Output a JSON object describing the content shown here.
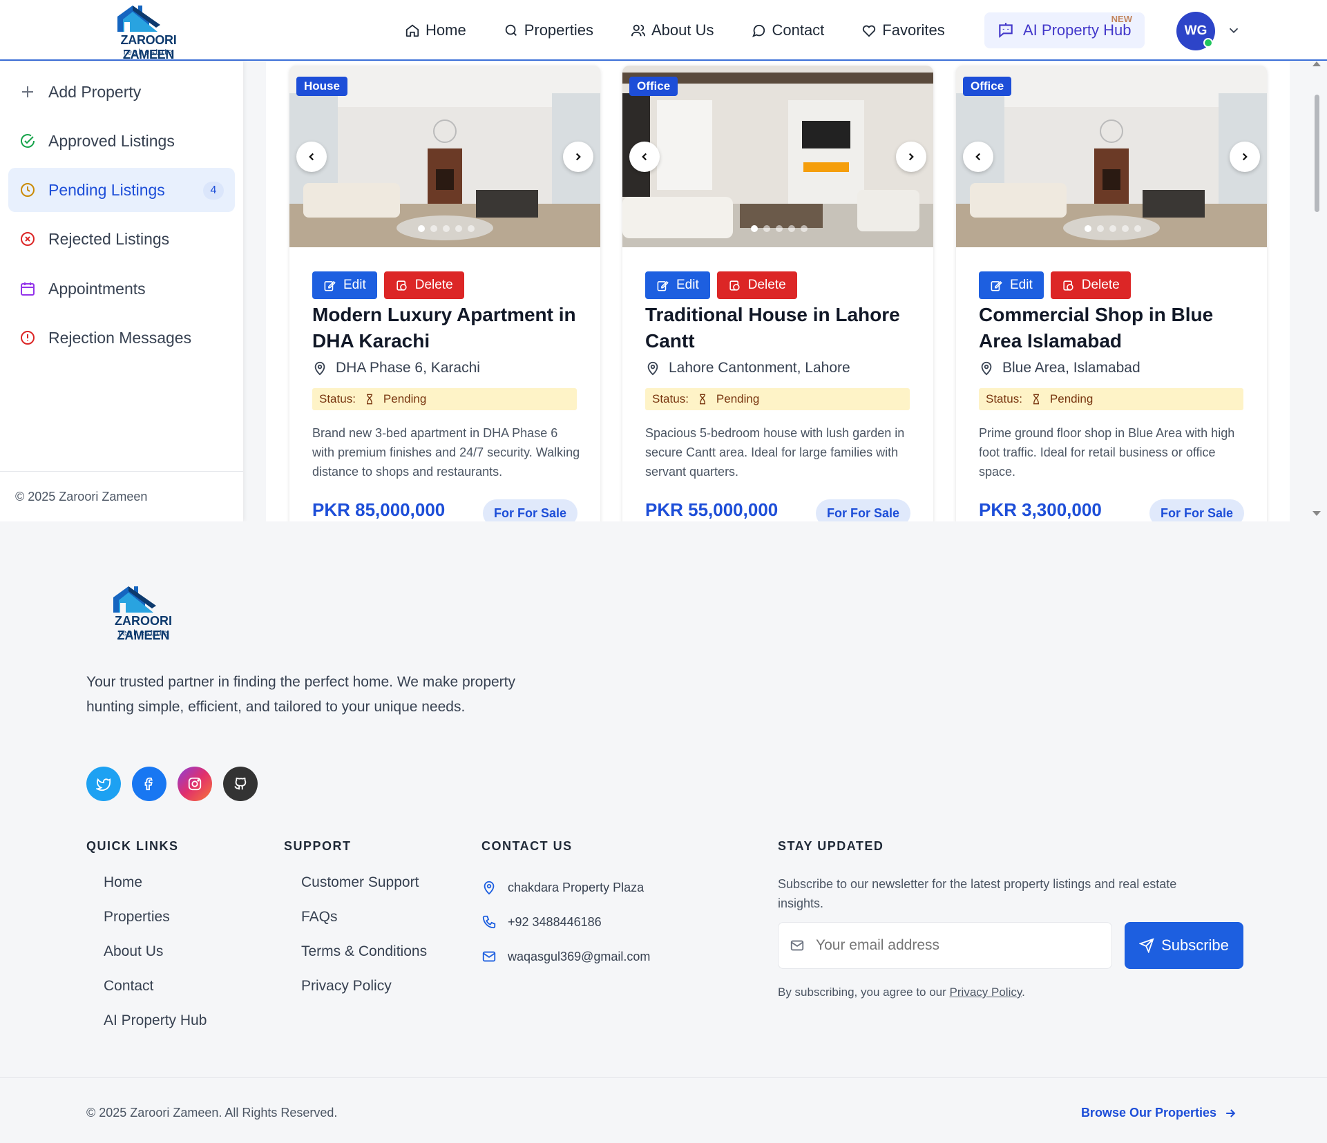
{
  "header": {
    "logo_text": "ZAROORI ZAMEEN",
    "logo_sub": "real estate",
    "nav": [
      "Home",
      "Properties",
      "About Us",
      "Contact",
      "Favorites"
    ],
    "ai_hub_label": "AI Property Hub",
    "ai_hub_badge": "NEW",
    "avatar_initials": "WG"
  },
  "sidebar": {
    "items": [
      {
        "label": "Add Property"
      },
      {
        "label": "Approved Listings"
      },
      {
        "label": "Pending Listings",
        "badge": "4"
      },
      {
        "label": "Rejected Listings"
      },
      {
        "label": "Appointments"
      },
      {
        "label": "Rejection Messages"
      }
    ],
    "footer": "© 2025 Zaroori Zameen"
  },
  "cards": [
    {
      "type": "House",
      "edit_label": "Edit",
      "delete_label": "Delete",
      "title": "Modern Luxury Apartment in DHA Karachi",
      "location": "DHA Phase 6, Karachi",
      "status_label": "Status:",
      "status_value": "Pending",
      "description": "Brand new 3-bed apartment in DHA Phase 6 with premium finishes and 24/7 security. Walking distance to shops and restaurants.",
      "price": "PKR 85,000,000",
      "sale_label": "For For Sale"
    },
    {
      "type": "Office",
      "edit_label": "Edit",
      "delete_label": "Delete",
      "title": "Traditional House in Lahore Cantt",
      "location": "Lahore Cantonment, Lahore",
      "status_label": "Status:",
      "status_value": "Pending",
      "description": "Spacious 5-bedroom house with lush garden in secure Cantt area. Ideal for large families with servant quarters.",
      "price": "PKR 55,000,000",
      "sale_label": "For For Sale"
    },
    {
      "type": "Office",
      "edit_label": "Edit",
      "delete_label": "Delete",
      "title": "Commercial Shop in Blue Area Islamabad",
      "location": "Blue Area, Islamabad",
      "status_label": "Status:",
      "status_value": "Pending",
      "description": "Prime ground floor shop in Blue Area with high foot traffic. Ideal for retail business or office space.",
      "price": "PKR 3,300,000",
      "sale_label": "For For Sale"
    }
  ],
  "footer": {
    "logo_text": "ZAROORI ZAMEEN",
    "logo_sub": "real estate",
    "about": "Your trusted partner in finding the perfect home. We make property hunting simple, efficient, and tailored to your unique needs.",
    "quick_links_title": "QUICK LINKS",
    "quick_links": [
      "Home",
      "Properties",
      "About Us",
      "Contact",
      "AI Property Hub"
    ],
    "support_title": "SUPPORT",
    "support_links": [
      "Customer Support",
      "FAQs",
      "Terms & Conditions",
      "Privacy Policy"
    ],
    "contact_title": "CONTACT US",
    "contact": {
      "address": "chakdara Property Plaza",
      "phone": "+92 3488446186",
      "email": "waqasgul369@gmail.com"
    },
    "stay_title": "STAY UPDATED",
    "stay_text": "Subscribe to our newsletter for the latest property listings and real estate insights.",
    "email_placeholder": "Your email address",
    "subscribe_label": "Subscribe",
    "sub_note_prefix": "By subscribing, you agree to our",
    "sub_note_link": "Privacy Policy",
    "sub_note_suffix": ".",
    "copyright": "© 2025 Zaroori Zameen. All Rights Reserved.",
    "browse_label": "Browse Our Properties"
  },
  "colors": {
    "primary": "#1d5fe0",
    "danger": "#dc2626",
    "pending_bg": "#fef3c7",
    "accent_indigo": "#4338ca"
  }
}
